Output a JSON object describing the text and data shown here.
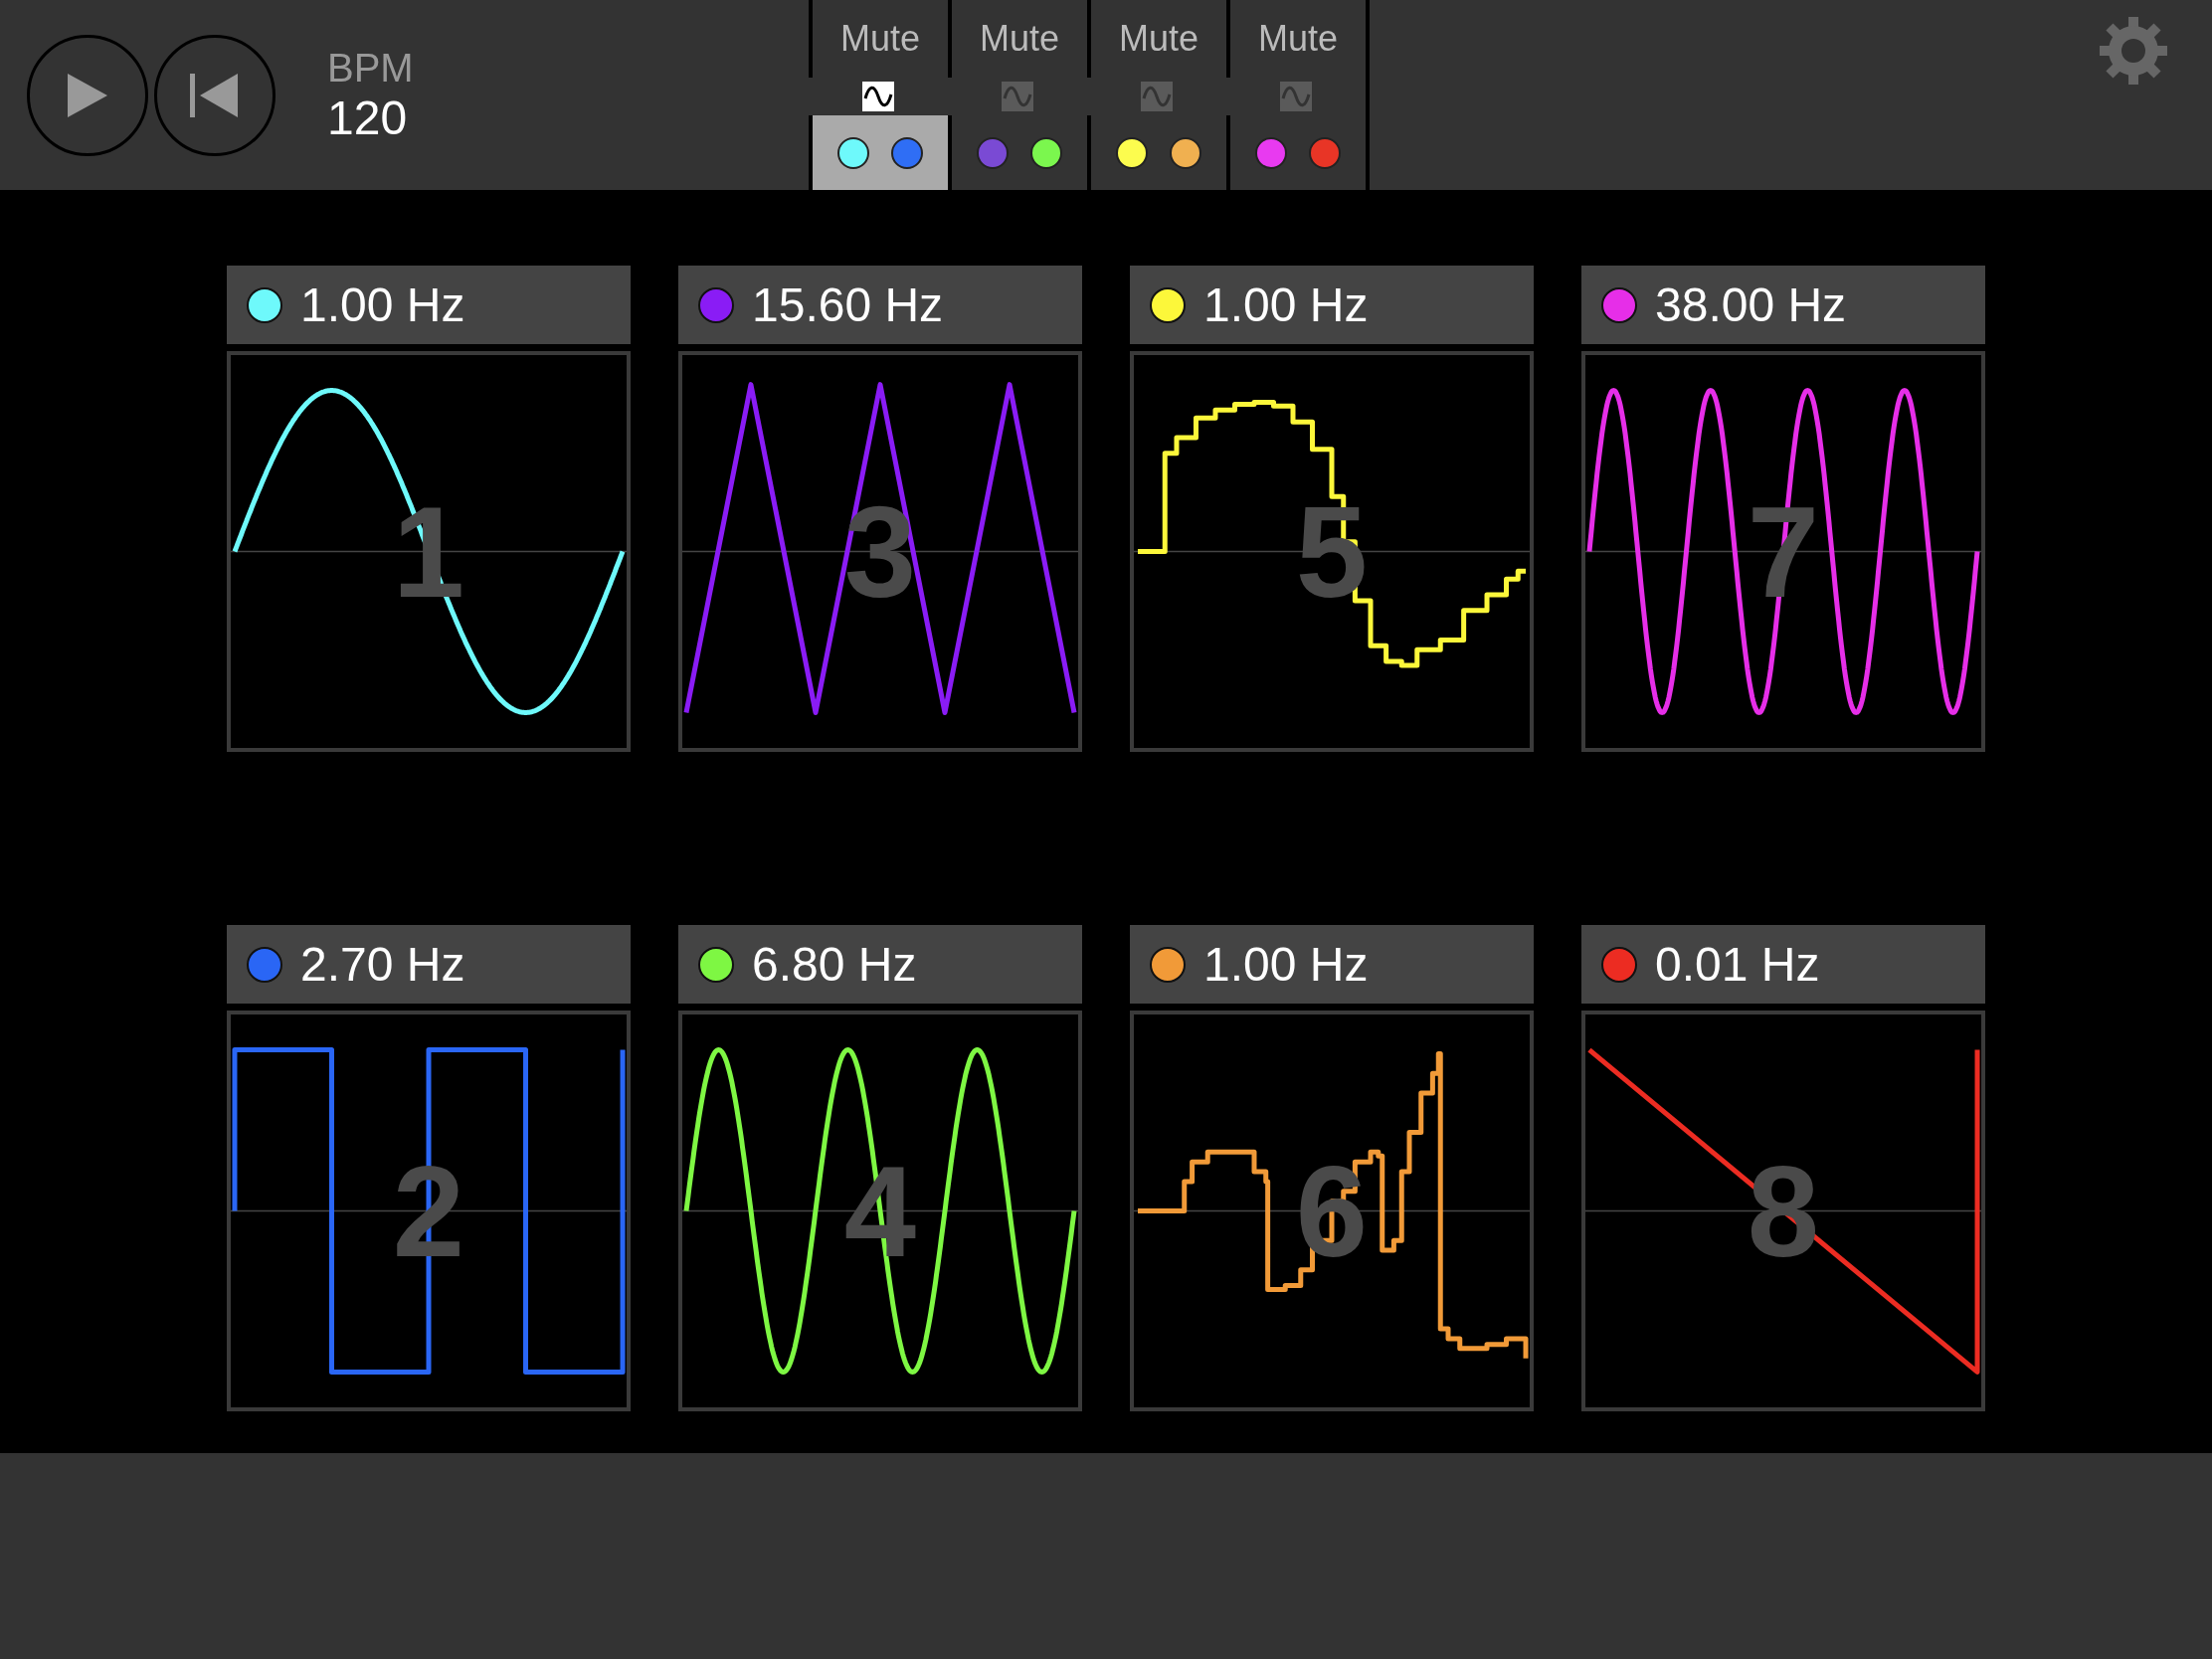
{
  "transport": [
    {
      "kind": "play"
    },
    {
      "kind": "rewind"
    }
  ],
  "bpm": {
    "label": "BPM",
    "value": "120"
  },
  "tracks": [
    {
      "mute": "Mute",
      "selected": true,
      "dots": [
        {
          "color": "#6ef9fb"
        },
        {
          "color": "#2f6ef5"
        }
      ]
    },
    {
      "mute": "Mute",
      "selected": false,
      "dots": [
        {
          "color": "#7a4ad4"
        },
        {
          "color": "#7bf74e"
        }
      ]
    },
    {
      "mute": "Mute",
      "selected": false,
      "dots": [
        {
          "color": "#fcfc4e"
        },
        {
          "color": "#f0b050"
        }
      ]
    },
    {
      "mute": "Mute",
      "selected": false,
      "dots": [
        {
          "color": "#e83af0"
        },
        {
          "color": "#e83526"
        }
      ]
    }
  ],
  "cards": [
    {
      "number": "1",
      "frequency": "1.00 Hz",
      "color": "#6ef9fb",
      "kind": "sine"
    },
    {
      "number": "3",
      "frequency": "15.60 Hz",
      "color": "#8a1cf5",
      "kind": "triangle"
    },
    {
      "number": "5",
      "frequency": "1.00 Hz",
      "color": "#fcf73a",
      "kind": "random"
    },
    {
      "number": "7",
      "frequency": "38.00 Hz",
      "color": "#e62ee8",
      "kind": "sine"
    },
    {
      "number": "2",
      "frequency": "2.70 Hz",
      "color": "#2a66f5",
      "kind": "square"
    },
    {
      "number": "4",
      "frequency": "6.80 Hz",
      "color": "#7ef743",
      "kind": "sine"
    },
    {
      "number": "6",
      "frequency": "1.00 Hz",
      "color": "#f19a38",
      "kind": "random"
    },
    {
      "number": "8",
      "frequency": "0.01 Hz",
      "color": "#ec2c22",
      "kind": "saw"
    }
  ]
}
